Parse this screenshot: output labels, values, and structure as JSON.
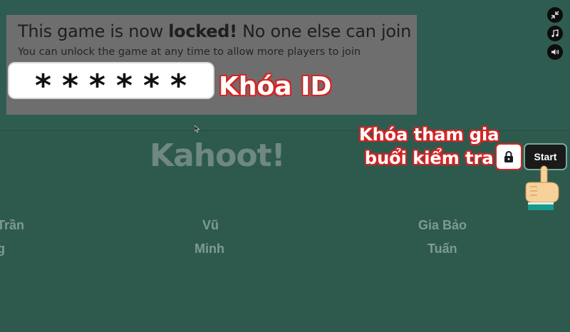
{
  "lock_panel": {
    "title_prefix": "This game is now ",
    "title_bold": "locked!",
    "title_suffix": " No one else can join",
    "subtitle": "You can unlock the game at any time to allow more players to join"
  },
  "pin": {
    "masked": "******"
  },
  "annotations": {
    "id_label": "Khóa ID",
    "join_line1": "Khóa tham gia",
    "join_line2": "buổi kiểm tra"
  },
  "side_icons": [
    "minimize-icon",
    "music-icon",
    "sound-icon"
  ],
  "logo": "Kahoot!",
  "controls": {
    "lock_icon": "lock-icon",
    "start_label": "Start"
  },
  "players": {
    "col1": [
      "Trần",
      "g"
    ],
    "col2": [
      "Vũ",
      "Minh"
    ],
    "col3": [
      "Gia Bảo",
      "Tuấn"
    ]
  },
  "colors": {
    "background": "#2e5a4e",
    "panel": "#6e6e6e",
    "annotation_outline": "#d42424",
    "start_button": "#1a1a1a"
  }
}
